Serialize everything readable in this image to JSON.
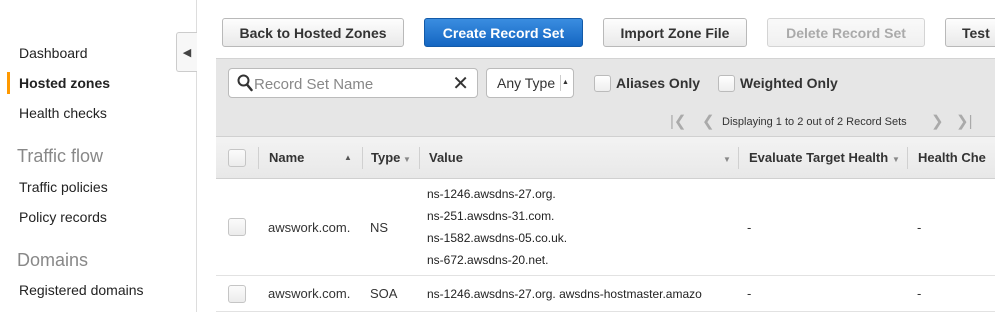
{
  "sidebar": {
    "items": [
      {
        "label": "Dashboard"
      },
      {
        "label": "Hosted zones"
      },
      {
        "label": "Health checks"
      }
    ],
    "traffic_flow": {
      "heading": "Traffic flow",
      "items": [
        {
          "label": "Traffic policies"
        },
        {
          "label": "Policy records"
        }
      ]
    },
    "domains": {
      "heading": "Domains",
      "items": [
        {
          "label": "Registered domains"
        }
      ]
    },
    "collapse_glyph": "◀"
  },
  "toolbar": {
    "back_label": "Back to Hosted Zones",
    "create_label": "Create Record Set",
    "import_label": "Import Zone File",
    "delete_label": "Delete Record Set",
    "test_label": "Test"
  },
  "filters": {
    "search_placeholder": "Record Set Name",
    "type_select": "Any Type",
    "aliases_only": "Aliases Only",
    "weighted_only": "Weighted Only"
  },
  "pagination": {
    "text": "Displaying 1 to 2 out of 2 Record Sets"
  },
  "table": {
    "headers": {
      "name": "Name",
      "type": "Type",
      "value": "Value",
      "evaluate": "Evaluate Target Health",
      "health": "Health Che"
    },
    "rows": [
      {
        "name": "awswork.com.",
        "type": "NS",
        "values": [
          "ns-1246.awsdns-27.org.",
          "ns-251.awsdns-31.com.",
          "ns-1582.awsdns-05.co.uk.",
          "ns-672.awsdns-20.net."
        ],
        "evaluate": "-",
        "health": "-"
      },
      {
        "name": "awswork.com.",
        "type": "SOA",
        "values": [
          "ns-1246.awsdns-27.org. awsdns-hostmaster.amazo"
        ],
        "evaluate": "-",
        "health": "-"
      }
    ]
  }
}
